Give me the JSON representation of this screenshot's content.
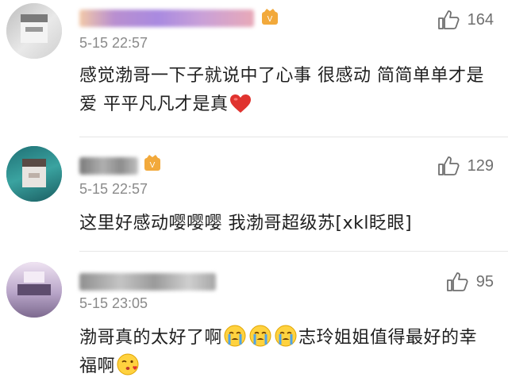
{
  "comments": [
    {
      "time": "5-15 22:57",
      "likes": "164",
      "text": "感觉渤哥一下子就说中了心事 很感动 简简单单才是爱 平平凡凡才是真",
      "icons": [
        "thumbs-up-icon",
        "heart-icon",
        "vip-badge-icon"
      ]
    },
    {
      "time": "5-15 22:57",
      "likes": "129",
      "text_a": "这里好感动嘤嘤嘤  我渤哥超级苏",
      "text_b": "[xkl眨眼]",
      "icons": [
        "thumbs-up-icon",
        "vip-badge-icon"
      ]
    },
    {
      "time": "5-15 23:05",
      "likes": "95",
      "text_a": "渤哥真的太好了啊",
      "text_b": "志玲姐姐值得最好的幸福啊",
      "icons": [
        "thumbs-up-icon",
        "crying-face-icon",
        "kissing-face-icon"
      ]
    }
  ],
  "colors": {
    "heart": "#e0332f",
    "badge": "#f2a93b",
    "text": "#1f1f1f",
    "meta": "#8a8a8a",
    "divider": "#e6e6e6"
  }
}
